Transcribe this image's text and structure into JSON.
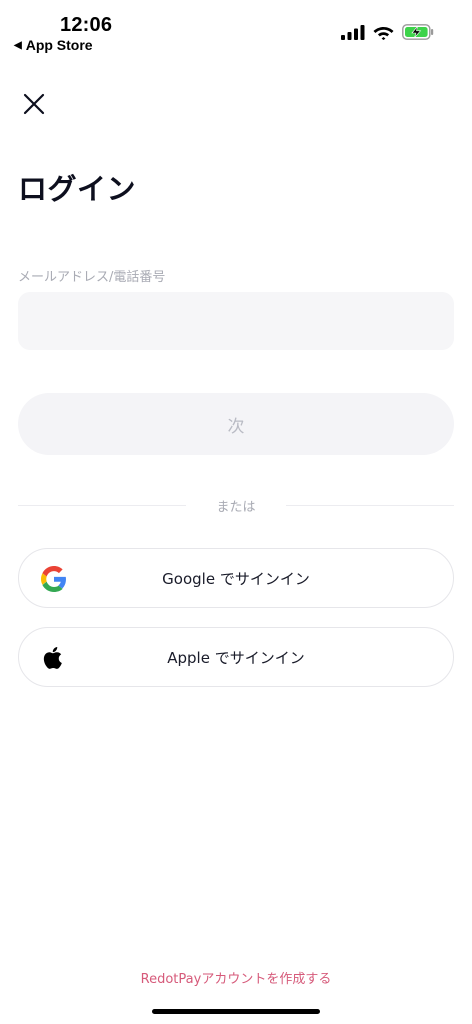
{
  "status_bar": {
    "time": "12:06",
    "back_label": "App Store",
    "icons": [
      "cellular-signal-icon",
      "wifi-icon",
      "battery-charging-icon"
    ]
  },
  "header": {
    "close_icon": "close-icon",
    "title": "ログイン"
  },
  "form": {
    "field_label": "メールアドレス/電話番号",
    "field_value": "",
    "next_label": "次"
  },
  "divider_text": "または",
  "social": {
    "google_label": "Google でサインイン",
    "google_icon": "google-logo-icon",
    "apple_label": "Apple でサインイン",
    "apple_icon": "apple-logo-icon"
  },
  "footer": {
    "create_account_label": "RedotPayアカウントを作成する"
  },
  "colors": {
    "link": "#d65a7a",
    "text_primary": "#0d0f1e",
    "muted": "#a9abb4",
    "input_bg": "#f6f6f8"
  }
}
